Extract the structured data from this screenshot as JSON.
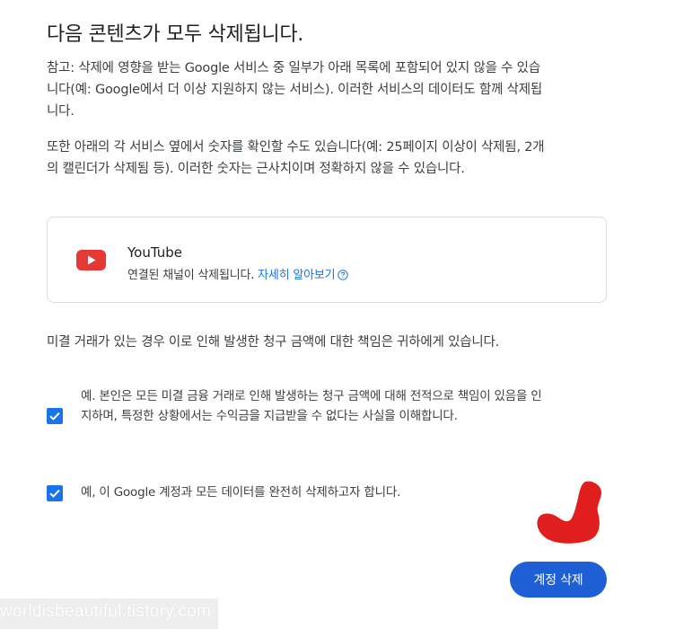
{
  "title": "다음 콘텐츠가 모두 삭제됩니다.",
  "paragraphs": {
    "note": "참고: 삭제에 영향을 받는 Google 서비스 중 일부가 아래 목록에 포함되어 있지 않을 수 있습니다(예: Google에서 더 이상 지원하지 않는 서비스). 이러한 서비스의 데이터도 함께 삭제됩니다.",
    "counts": "또한 아래의 각 서비스 옆에서 숫자를 확인할 수도 있습니다(예: 25페이지 이상이 삭제됨, 2개의 캘린더가 삭제됨 등). 이러한 숫자는 근사치이며 정확하지 않을 수 있습니다.",
    "liability": "미결 거래가 있는 경우 이로 인해 발생한 청구 금액에 대한 책임은 귀하에게 있습니다."
  },
  "service": {
    "icon": "youtube-icon",
    "name": "YouTube",
    "description": "연결된 채널이 삭제됩니다.",
    "link_label": "자세히 알아보기"
  },
  "checkboxes": [
    {
      "label": "예. 본인은 모든 미결 금융 거래로 인해 발생하는 청구 금액에 대해 전적으로 책임이 있음을 인지하며, 특정한 상황에서는 수익금을 지급받을 수 없다는 사실을 이해합니다.",
      "checked": true
    },
    {
      "label": "예, 이 Google 계정과 모든 데이터를 완전히 삭제하고자 합니다.",
      "checked": true
    }
  ],
  "delete_button_label": "계정 삭제",
  "watermark": "worldisbeautiful.tistory.com",
  "colors": {
    "accent": "#1a73e8",
    "youtube_red": "#e53935",
    "annotation_red": "#e01e1e"
  }
}
